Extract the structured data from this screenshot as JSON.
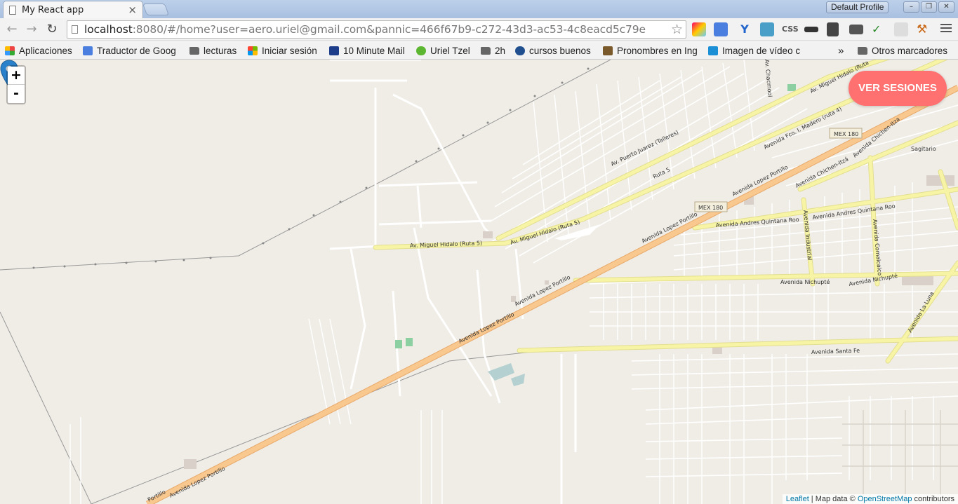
{
  "browser": {
    "tab_title": "My React app",
    "profile": "Default Profile",
    "url_host": "localhost",
    "url_rest": ":8080/#/home?user=aero.uriel@gmail.com&pannic=466f67b9-c272-43d3-ac53-4c8eacd5c79e"
  },
  "bookmarks": [
    {
      "label": "Aplicaciones",
      "icon": "apps-grid-icon"
    },
    {
      "label": "Traductor de Goog",
      "icon": "google-translate-icon"
    },
    {
      "label": "lecturas",
      "icon": "folder-icon"
    },
    {
      "label": "Iniciar sesión",
      "icon": "microsoft-icon"
    },
    {
      "label": "10 Minute Mail",
      "icon": "mail-icon"
    },
    {
      "label": "Uriel Tzel",
      "icon": "chat-icon"
    },
    {
      "label": "2h",
      "icon": "folder-icon"
    },
    {
      "label": "cursos buenos",
      "icon": "course-icon"
    },
    {
      "label": "Pronombres en Ing",
      "icon": "site-icon"
    },
    {
      "label": "Imagen de vídeo c",
      "icon": "video-icon"
    }
  ],
  "bookmarks_overflow": "»",
  "other_bookmarks": "Otros marcadores",
  "map": {
    "zoom_in": "+",
    "zoom_out": "-",
    "action_button": "VER SESIONES",
    "attribution": {
      "leaflet": "Leaflet",
      "sep": " | Map data © ",
      "osm": "OpenStreetMap",
      "contributors": " contributors"
    },
    "labels": [
      "Av. Miguel Hidalo (Ruta 5)",
      "Av. Miguel Hidalo (Ruta 5)",
      "Av. Puerto Juarez (Talleres)",
      "Ruta 5",
      "Avenida Lopez Portillo",
      "Avenida Lopez Portillo",
      "Avenida Lopez Portillo",
      "Avenida Lopez Portillo",
      "Avenida Lopez Portillo",
      "MEX 180",
      "MEX 180",
      "Avenida Andres Quintana Roo",
      "Avenida Andres Quintana Roo",
      "Avenida Nichupté",
      "Avenida Nichupté",
      "Avenida Santa Fe",
      "Avenida Chichen-Itzá",
      "Avenida Chichen-Itza",
      "Avenida Industrial",
      "Avenida Comalcalco",
      "Avenida Fco. I. Madero (ruta 4)",
      "Av. Miguel Hidalo (Ruta",
      "Sagitario",
      "Avenida La Luna",
      "Av. Chacmool",
      "Portillo"
    ]
  },
  "colors": {
    "accent_button": "#ff7070",
    "main_road": "#f8c88e",
    "secondary_road": "#f7f5a5",
    "map_bg": "#f0ede6",
    "marker": "#2a81cb"
  }
}
